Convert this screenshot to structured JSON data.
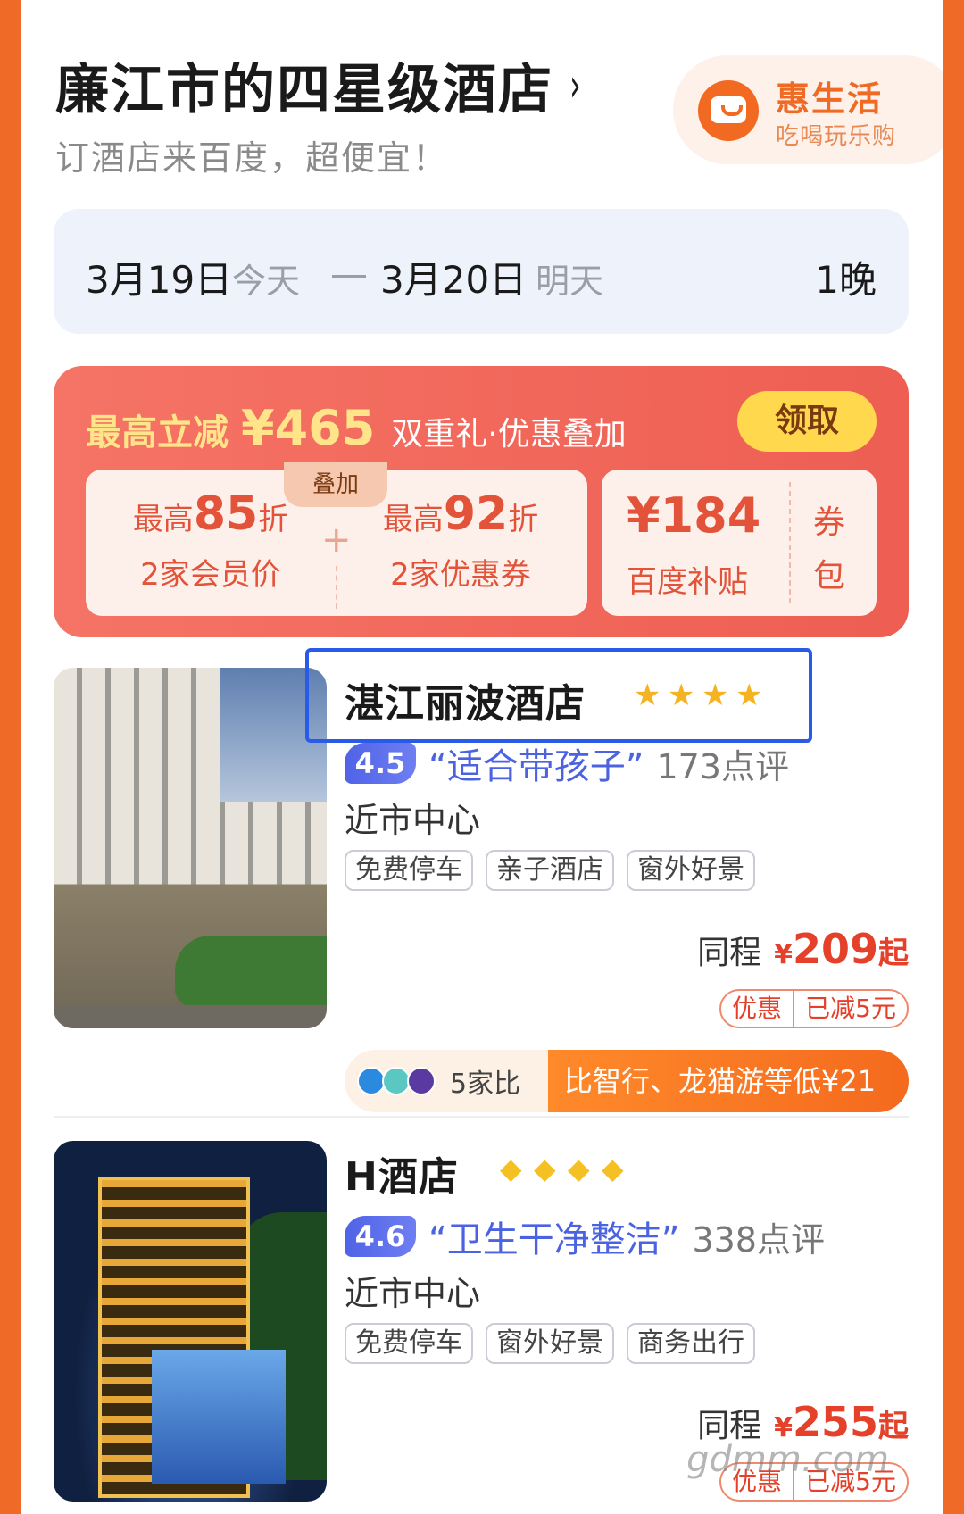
{
  "header": {
    "title": "廉江市的四星级酒店",
    "chevron": "›",
    "subtitle": "订酒店来百度，超便宜！"
  },
  "hui_badge": {
    "title": "惠生活",
    "subtitle": "吃喝玩乐购",
    "icon": "smile-bag-icon"
  },
  "dates": {
    "checkin": "3月19日",
    "checkin_label": "今天",
    "checkout": "3月20日",
    "checkout_label": "明天",
    "nights": "1晚"
  },
  "promo": {
    "label": "最高立减",
    "amount": "¥465",
    "desc": "双重礼·优惠叠加",
    "claim_label": "领取",
    "stack_tag": "叠加",
    "member": {
      "prefix": "最高",
      "value": "85",
      "suffix": "折",
      "note": "2家会员价"
    },
    "coupon": {
      "prefix": "最高",
      "value": "92",
      "suffix": "折",
      "note": "2家优惠券"
    },
    "plus": "+",
    "subsidy": {
      "amount": "¥184",
      "label": "百度补贴",
      "pack": "券包"
    }
  },
  "hotels": [
    {
      "name": "湛江丽波酒店",
      "rating_icon": "star",
      "rating_count": 4,
      "score": "4.5",
      "quote": "“适合带孩子”",
      "reviews": "173点评",
      "location": "近市中心",
      "tags": [
        "免费停车",
        "亲子酒店",
        "窗外好景"
      ],
      "source": "同程",
      "price_yen": "¥",
      "price": "209",
      "price_suffix": "起",
      "coupon_left": "优惠",
      "coupon_right": "已减5元",
      "compare_count": "5家比",
      "compare_text": "比智行、龙猫游等低¥21"
    },
    {
      "name": "H酒店",
      "rating_icon": "diamond",
      "rating_count": 4,
      "score": "4.6",
      "quote": "“卫生干净整洁”",
      "reviews": "338点评",
      "location": "近市中心",
      "tags": [
        "免费停车",
        "窗外好景",
        "商务出行"
      ],
      "source": "同程",
      "price_yen": "¥",
      "price": "255",
      "price_suffix": "起",
      "coupon_left": "优惠",
      "coupon_right": "已减5元"
    }
  ],
  "watermark": "gdmm.com",
  "colors": {
    "brand_orange": "#ee6a26",
    "promo_red": "#f06a5e",
    "price_red": "#e5402a",
    "score_blue": "#4f63e6",
    "highlight_blue": "#2a5ae8"
  }
}
